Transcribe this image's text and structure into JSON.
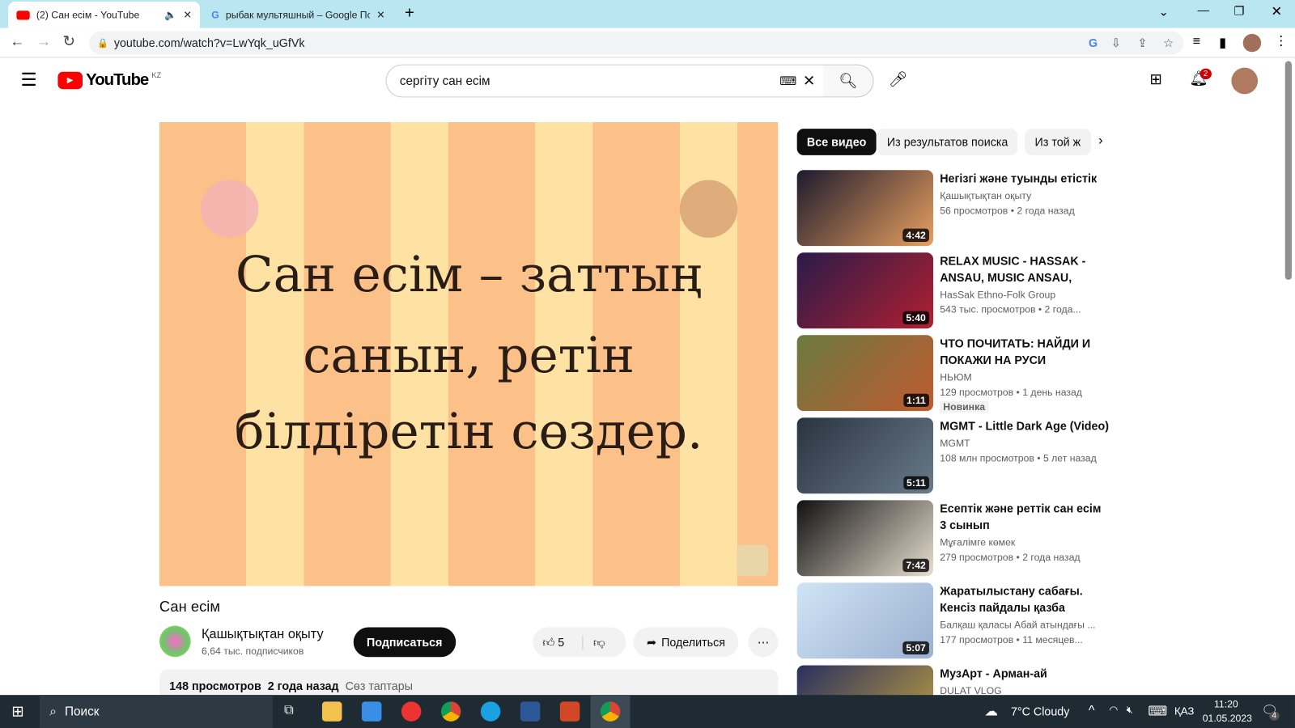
{
  "browser": {
    "tabs": [
      {
        "title": "(2) Сан есім - YouTube",
        "active": true
      },
      {
        "title": "рыбак мультяшный – Google По",
        "active": false
      }
    ],
    "url": "youtube.com/watch?v=LwYqk_uGfVk"
  },
  "youtube": {
    "logo": "YouTube",
    "region": "KZ",
    "search_value": "сергіту сан есім",
    "notifications": "2"
  },
  "video": {
    "slide_lines": [
      "Сан есім – заттың",
      "санын, ретін",
      "білдіретін сөздер."
    ],
    "title": "Сан есім",
    "channel": "Қашықтықтан оқыту",
    "subscribers": "6,64 тыс. подписчиков",
    "subscribe_label": "Подписаться",
    "likes": "5",
    "share_label": "Поделиться",
    "views": "148 просмотров",
    "date": "2 года назад",
    "tags": "Сөз таптары"
  },
  "chips": [
    "Все видео",
    "Из результатов поиска",
    "Из той ж"
  ],
  "recommendations": [
    {
      "title": "Негізгі және туынды етістік",
      "channel": "Қашықтықтан оқыту",
      "views": "56 просмотров",
      "age": "2 года назад",
      "duration": "4:42",
      "colors": [
        "#1d1a2e",
        "#e8a060"
      ]
    },
    {
      "title": "RELAX MUSIC - HASSAK - ANSAU, MUSIC ANSAU, SONG...",
      "channel": "HasSak Ethno-Folk Group",
      "views": "543 тыс. просмотров",
      "age": "2 года...",
      "duration": "5:40",
      "colors": [
        "#2a1a4a",
        "#b02030"
      ]
    },
    {
      "title": "ЧТО ПОЧИТАТЬ: НАЙДИ И ПОКАЖИ НА РУСИ",
      "channel": "НЬЮМ",
      "views": "129 просмотров",
      "age": "1 день назад",
      "duration": "1:11",
      "badge": "Новинка",
      "colors": [
        "#6a7a40",
        "#c05a30"
      ]
    },
    {
      "title": "MGMT - Little Dark Age (Video)",
      "channel": "MGMT",
      "views": "108 млн просмотров",
      "age": "5 лет назад",
      "duration": "5:11",
      "colors": [
        "#2a3440",
        "#6a7a8a"
      ]
    },
    {
      "title": "Есептік және реттік сан есім 3 сынып",
      "channel": "Мұғалімге көмек",
      "views": "279 просмотров",
      "age": "2 года назад",
      "duration": "7:42",
      "colors": [
        "#111",
        "#e8e0d0"
      ]
    },
    {
      "title": "Жаратылыстану сабағы. Кенсіз пайдалы қазба деген...",
      "channel": "Балқаш қаласы Абай атындағы ...",
      "views": "177 просмотров",
      "age": "11 месяцев...",
      "duration": "5:07",
      "colors": [
        "#cfe4f4",
        "#9ab0d0"
      ]
    },
    {
      "title": "МузАрт - Арман-ай",
      "channel": "DULAT VLOG",
      "colors": [
        "#2a3060",
        "#c0a040"
      ]
    }
  ],
  "taskbar": {
    "search": "Поиск",
    "weather": "7°C  Cloudy",
    "lang": "ҚАЗ",
    "time": "11:20",
    "date": "01.05.2023",
    "notif": "4"
  }
}
